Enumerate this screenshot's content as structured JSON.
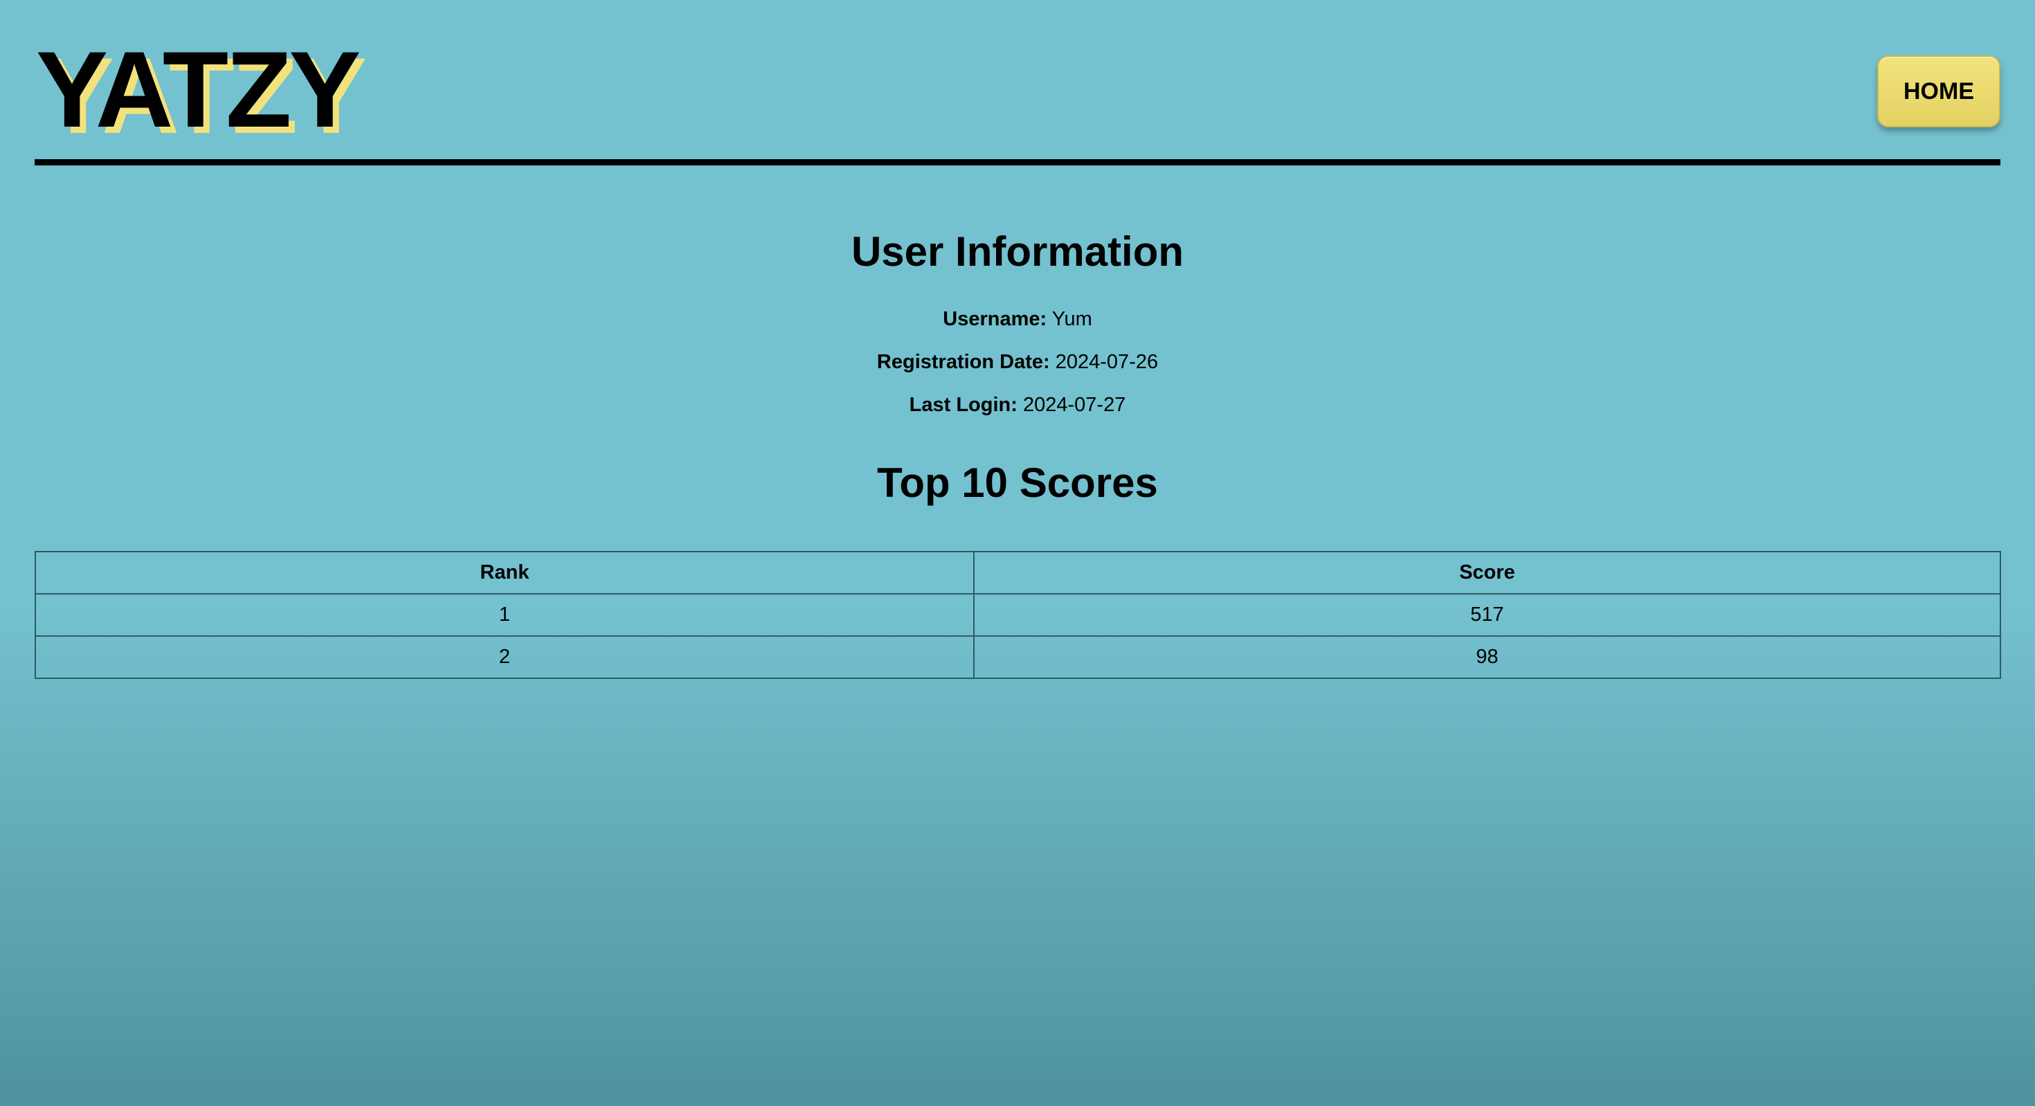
{
  "header": {
    "logo": "YATZY",
    "home_label": "HOME"
  },
  "user_info": {
    "title": "User Information",
    "username_label": "Username:",
    "username": "Yum",
    "registration_label": "Registration Date:",
    "registration_date": "2024-07-26",
    "last_login_label": "Last Login:",
    "last_login": "2024-07-27"
  },
  "scores": {
    "title": "Top 10 Scores",
    "columns": [
      "Rank",
      "Score"
    ],
    "rows": [
      {
        "rank": "1",
        "score": "517"
      },
      {
        "rank": "2",
        "score": "98"
      }
    ]
  },
  "colors": {
    "background_top": "#74c1cf",
    "background_bottom": "#4f929e",
    "accent_yellow": "#f1e27d"
  }
}
